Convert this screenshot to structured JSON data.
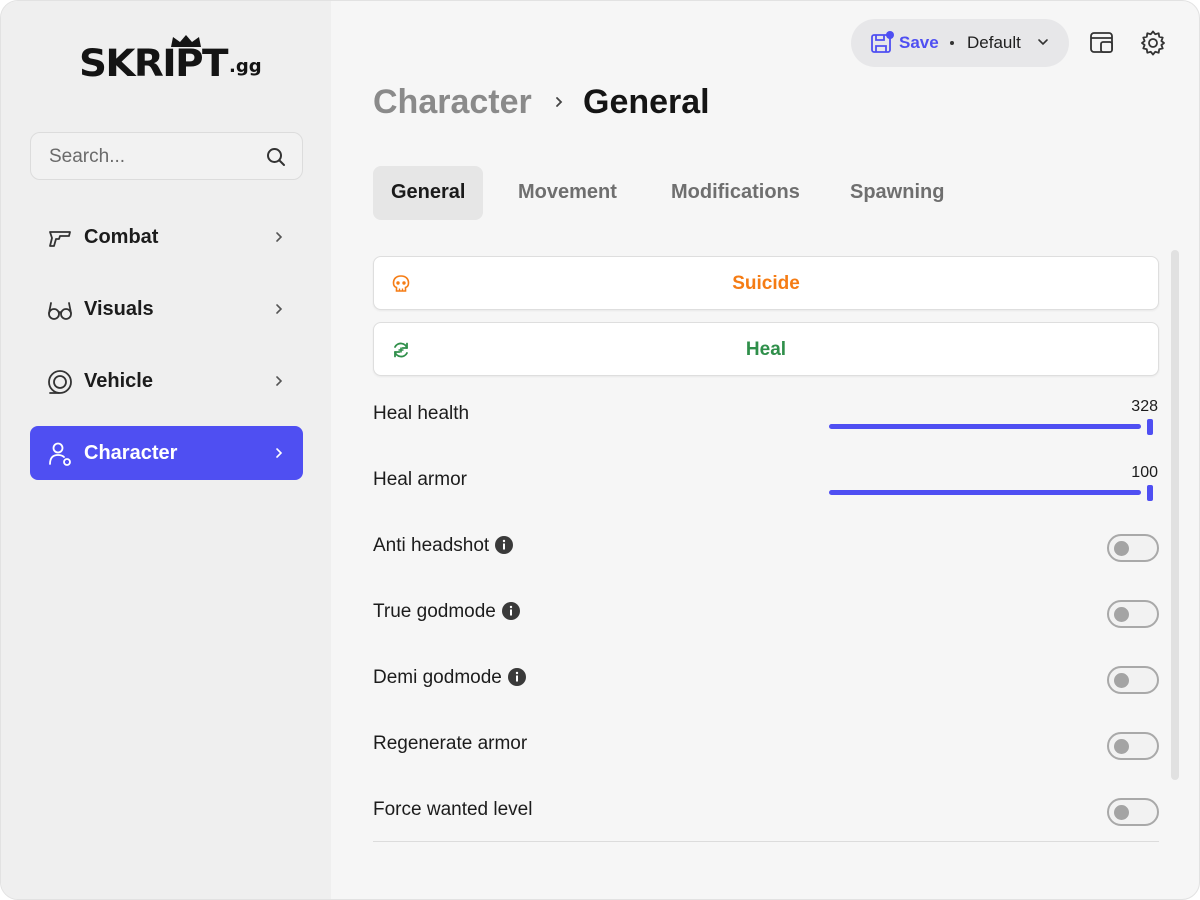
{
  "app": {
    "logo_text": "SKRIPT",
    "logo_suffix": ".gg"
  },
  "sidebar": {
    "search_placeholder": "Search...",
    "items": [
      {
        "label": "Combat",
        "icon": "gun-icon",
        "active": false
      },
      {
        "label": "Visuals",
        "icon": "glasses-icon",
        "active": false
      },
      {
        "label": "Vehicle",
        "icon": "wheel-icon",
        "active": false
      },
      {
        "label": "Character",
        "icon": "user-icon",
        "active": true
      }
    ]
  },
  "topbar": {
    "save_label": "Save",
    "profile_label": "Default",
    "icons": [
      "window-icon",
      "gear-icon"
    ]
  },
  "breadcrumb": {
    "parent": "Character",
    "current": "General"
  },
  "tabs": [
    {
      "label": "General",
      "active": true
    },
    {
      "label": "Movement",
      "active": false
    },
    {
      "label": "Modifications",
      "active": false
    },
    {
      "label": "Spawning",
      "active": false
    }
  ],
  "actions": [
    {
      "label": "Suicide",
      "icon": "skull-icon",
      "color": "#f57c14"
    },
    {
      "label": "Heal",
      "icon": "refresh-icon",
      "color": "#2f8f4a"
    }
  ],
  "sliders": [
    {
      "label": "Heal health",
      "value": "328"
    },
    {
      "label": "Heal armor",
      "value": "100"
    }
  ],
  "toggles": [
    {
      "label": "Anti headshot",
      "info": true,
      "on": false
    },
    {
      "label": "True godmode",
      "info": true,
      "on": false
    },
    {
      "label": "Demi godmode",
      "info": true,
      "on": false
    },
    {
      "label": "Regenerate armor",
      "info": false,
      "on": false
    },
    {
      "label": "Force wanted level",
      "info": false,
      "on": false
    }
  ],
  "colors": {
    "accent": "#4f4ff2",
    "sidebar_bg": "#efefef",
    "content_bg": "#f6f6f6"
  }
}
